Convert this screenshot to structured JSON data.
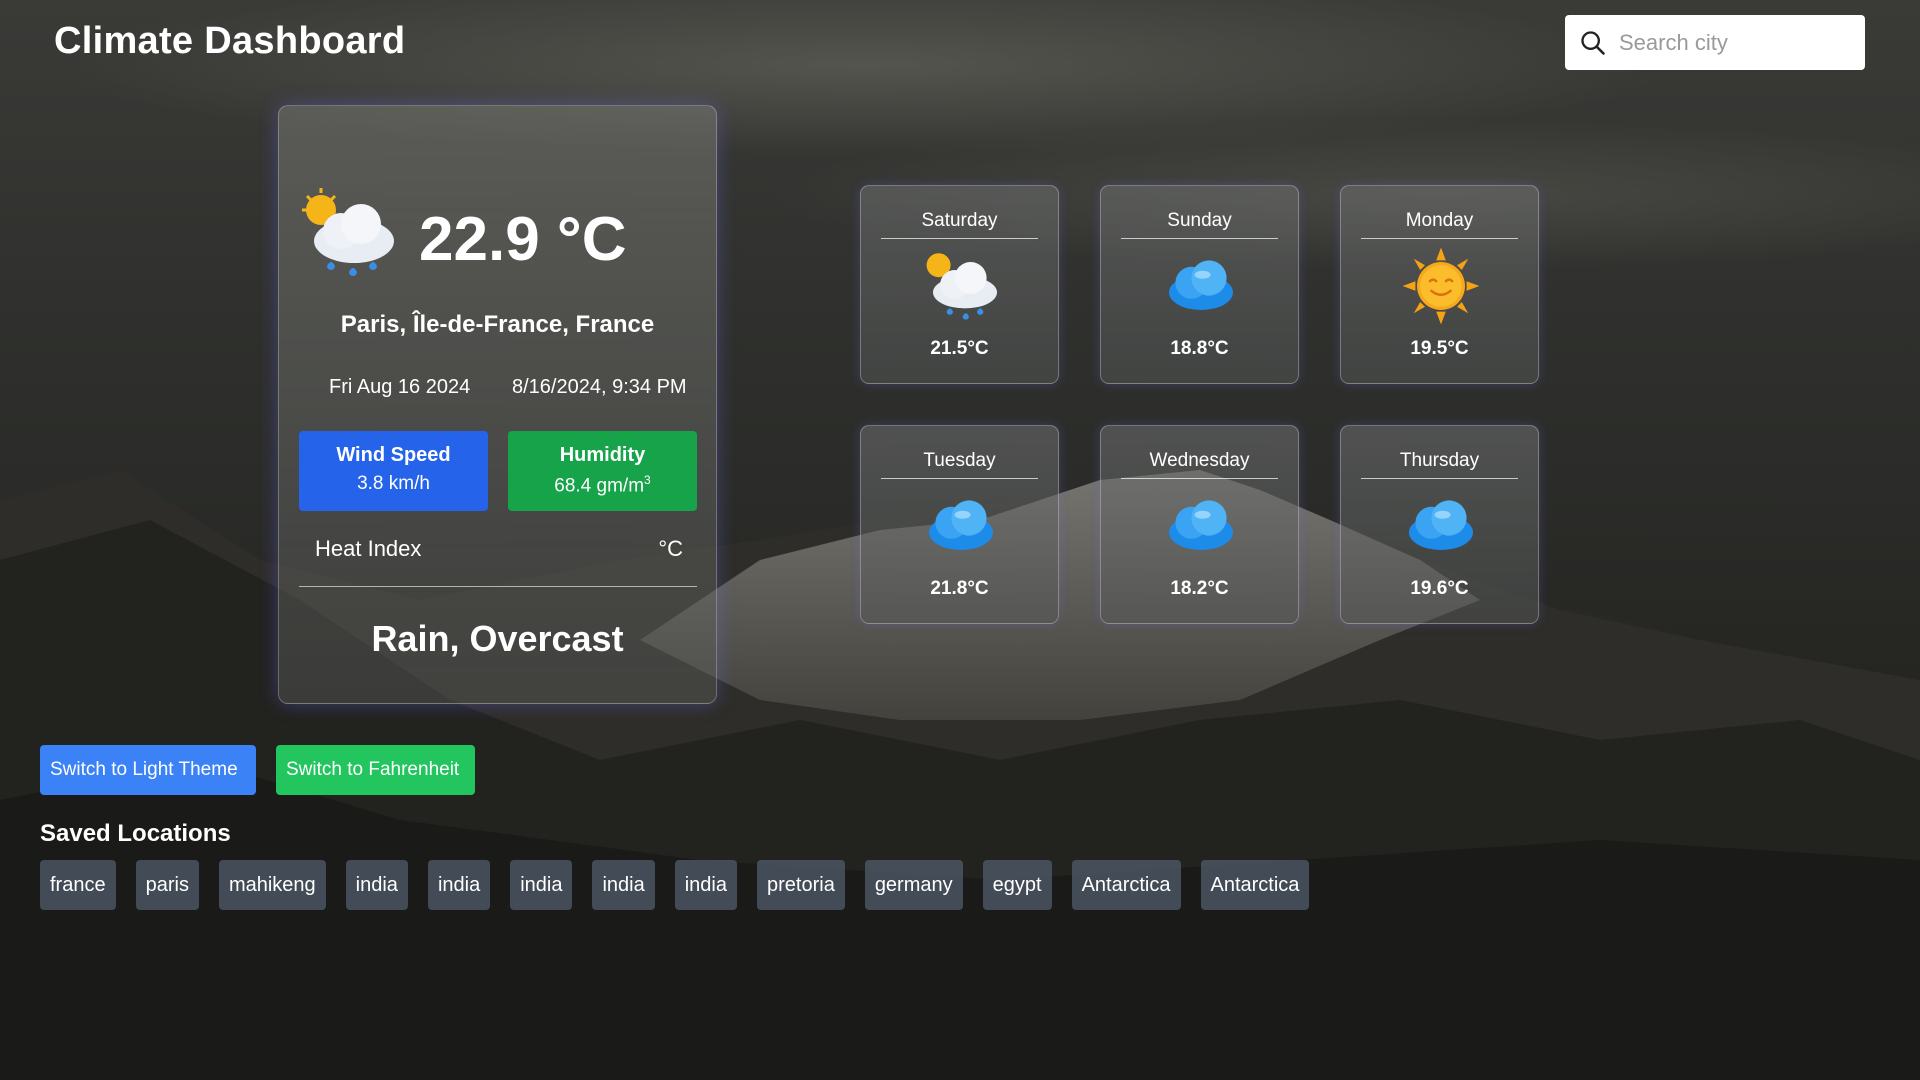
{
  "app": {
    "title": "Climate Dashboard"
  },
  "search": {
    "placeholder": "Search city",
    "icon": "search-icon"
  },
  "current": {
    "icon": "sun-cloud-rain-icon",
    "temperature": "22.9 °C",
    "location": "Paris, Île-de-France, France",
    "date": "Fri Aug 16 2024",
    "datetime": "8/16/2024, 9:34 PM",
    "wind": {
      "label": "Wind Speed",
      "value": "3.8 km/h",
      "color": "#2563eb"
    },
    "humidity": {
      "label": "Humidity",
      "value": "68.4 gm/m",
      "unit_sup": "3",
      "color": "#16a34a"
    },
    "heat_index": {
      "label": "Heat Index",
      "unit": "°C"
    },
    "condition": "Rain, Overcast"
  },
  "forecast": [
    {
      "day": "Saturday",
      "temp": "21.5°C",
      "icon": "sun-cloud-rain-icon"
    },
    {
      "day": "Sunday",
      "temp": "18.8°C",
      "icon": "cloud-icon"
    },
    {
      "day": "Monday",
      "temp": "19.5°C",
      "icon": "sun-icon"
    },
    {
      "day": "Tuesday",
      "temp": "21.8°C",
      "icon": "cloud-icon"
    },
    {
      "day": "Wednesday",
      "temp": "18.2°C",
      "icon": "cloud-icon"
    },
    {
      "day": "Thursday",
      "temp": "19.6°C",
      "icon": "cloud-icon"
    }
  ],
  "buttons": {
    "theme": "Switch to Light Theme",
    "unit": "Switch to Fahrenheit"
  },
  "saved": {
    "title": "Saved Locations",
    "items": [
      "france",
      "paris",
      "mahikeng",
      "india",
      "india",
      "india",
      "india",
      "india",
      "pretoria",
      "germany",
      "egypt",
      "Antarctica",
      "Antarctica"
    ]
  }
}
